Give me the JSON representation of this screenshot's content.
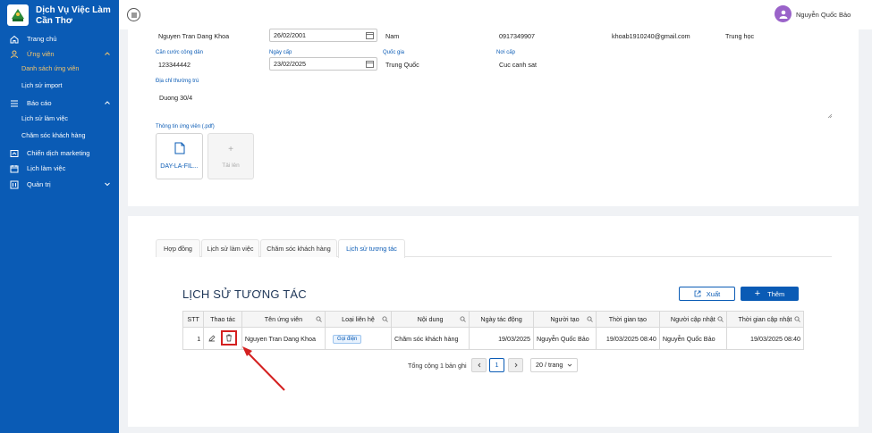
{
  "sidebar": {
    "brand": "Dịch Vụ Việc Làm Cần Thơ",
    "items": [
      {
        "label": "Trang chủ",
        "icon": "home-icon"
      },
      {
        "label": "Ứng viên",
        "icon": "user-icon"
      },
      {
        "label": "Danh sách ứng viên"
      },
      {
        "label": "Lịch sử import"
      },
      {
        "label": "Báo cáo",
        "icon": "list-icon"
      },
      {
        "label": "Lịch sử làm việc"
      },
      {
        "label": "Chăm sóc khách hàng"
      },
      {
        "label": "Chiến dịch marketing",
        "icon": "campaign-icon"
      },
      {
        "label": "Lịch làm việc",
        "icon": "calendar-icon"
      },
      {
        "label": "Quản trị",
        "icon": "admin-icon"
      }
    ]
  },
  "header": {
    "user_name": "Nguyễn Quốc Bảo"
  },
  "profile": {
    "name": "Nguyen Tran Dang Khoa",
    "dob": "26/02/2001",
    "gender": "Nam",
    "phone": "0917349907",
    "email": "khoab1910240@gmail.com",
    "education": "Trung học",
    "id_label": "Căn cước công dân",
    "id_value": "123344442",
    "issue_date_label": "Ngày cấp",
    "issue_date": "23/02/2025",
    "nationality_label": "Quốc gia",
    "nationality": "Trung Quốc",
    "issue_place_label": "Nơi cấp",
    "issue_place": "Cuc canh sat",
    "address_label": "Địa chỉ thường trú",
    "address": "Duong 30/4",
    "pdf_label": "Thông tin ứng viên (.pdf)",
    "file_name": "DAY-LA-FIL...",
    "upload_label": "Tải lên",
    "upload_plus": "+"
  },
  "tabs": [
    "Hợp đồng",
    "Lịch sử làm việc",
    "Chăm sóc khách hàng",
    "Lịch sử tương tác"
  ],
  "section": {
    "title": "LỊCH SỬ TƯƠNG TÁC",
    "export_label": "Xuất",
    "add_label": "Thêm",
    "add_plus": "+"
  },
  "table": {
    "headers": [
      "STT",
      "Thao tác",
      "Tên ứng viên",
      "Loại liên hệ",
      "Nội dung",
      "Ngày tác động",
      "Người tạo",
      "Thời gian tạo",
      "Người cập nhật",
      "Thời gian cập nhật"
    ],
    "row": {
      "stt": "1",
      "candidate": "Nguyen Tran Dang Khoa",
      "contact_type": "Gọi điện",
      "content": "Chăm sóc khách hàng",
      "action_date": "19/03/2025",
      "creator": "Nguyễn Quốc Bảo",
      "created_at": "19/03/2025 08:40",
      "updater": "Nguyễn Quốc Bảo",
      "updated_at": "19/03/2025 08:40"
    }
  },
  "pagination": {
    "total": "Tổng cộng 1 bản ghi",
    "page": "1",
    "page_size": "20 / trang"
  },
  "colors": {
    "primary": "#0a5bb5",
    "active_nav": "#f7c66a",
    "highlight": "#d42020"
  }
}
